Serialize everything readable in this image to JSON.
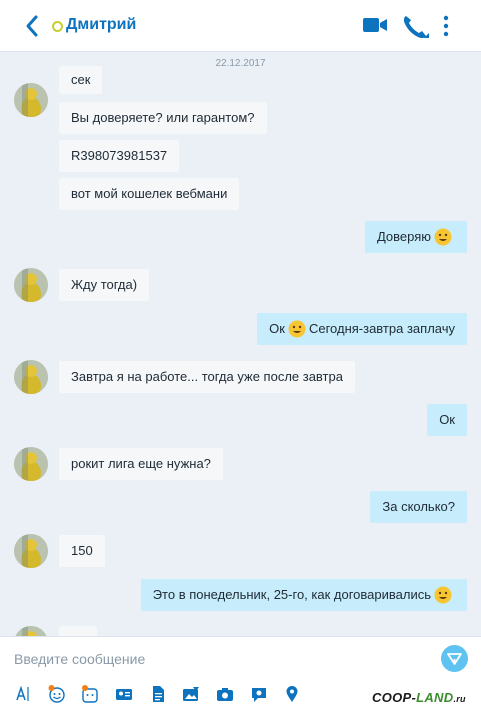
{
  "header": {
    "contact_name": "Дмитрий",
    "accent": "#0d73bf"
  },
  "chat": {
    "date": "22.12.2017",
    "messages": [
      {
        "dir": "in",
        "text": "сек"
      },
      {
        "dir": "in",
        "text": "Вы доверяете? или гарантом?"
      },
      {
        "dir": "in",
        "text": "R398073981537"
      },
      {
        "dir": "in",
        "text": "вот мой кошелек вебмани"
      },
      {
        "dir": "out",
        "text": "Доверяю",
        "emoji_after": "smile"
      },
      {
        "dir": "in",
        "text": "Жду тогда)"
      },
      {
        "dir": "out",
        "text_before": "Ок",
        "emoji": "smile",
        "text": "Сегодня-завтра заплачу"
      },
      {
        "dir": "in",
        "text": "Завтра я на работе... тогда уже после завтра"
      },
      {
        "dir": "out",
        "text": "Ок"
      },
      {
        "dir": "in",
        "text": "рокит лига еще нужна?"
      },
      {
        "dir": "out",
        "text": "За сколько?"
      },
      {
        "dir": "in",
        "text": "150"
      },
      {
        "dir": "out",
        "text": "Это в понедельник, 25-го, как договаривались",
        "emoji_after": "smile"
      }
    ]
  },
  "composer": {
    "placeholder": "Введите сообщение",
    "tools": [
      "text-format-icon",
      "emoticon-icon",
      "sticker-icon",
      "contact-card-icon",
      "file-icon",
      "image-icon",
      "camera-icon",
      "video-message-icon",
      "location-icon"
    ]
  },
  "watermark": {
    "main": "COOP-",
    "tail": "LAND",
    "suffix": ".ru"
  },
  "colors": {
    "incoming_bubble": "#f5f7f9",
    "outgoing_bubble": "#c7ecfb",
    "send_button": "#5ec3f0"
  }
}
